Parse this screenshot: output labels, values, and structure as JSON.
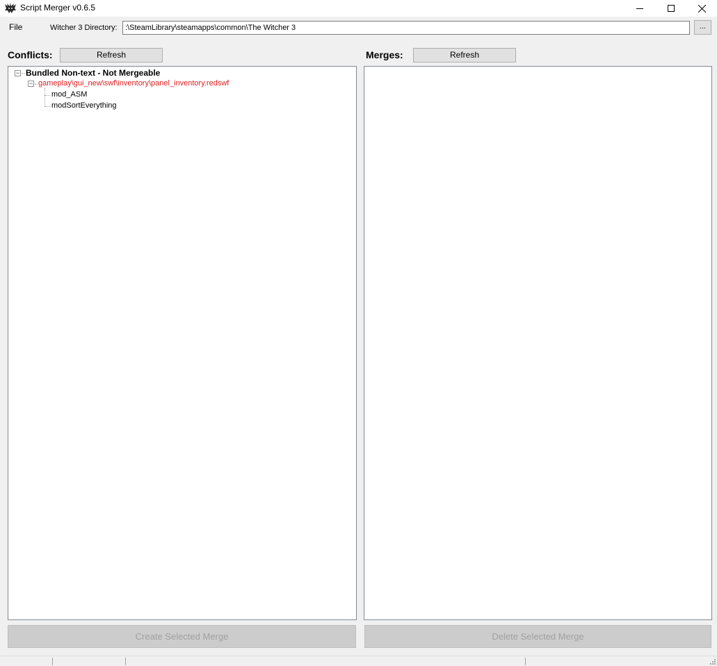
{
  "window": {
    "title": "Script Merger v0.6.5",
    "icons": [
      "witcher-wolf-icon",
      "minimize-icon",
      "maximize-icon",
      "close-icon"
    ]
  },
  "menu": {
    "file": "File"
  },
  "directory": {
    "label": "Witcher 3 Directory:",
    "value": ":\\SteamLibrary\\steamapps\\common\\The Witcher 3",
    "browse_label": "..."
  },
  "conflicts": {
    "label": "Conflicts:",
    "refresh_label": "Refresh",
    "tree": {
      "category": "Bundled Non-text - Not Mergeable",
      "file": "gameplay\\gui_new\\swf\\inventory\\panel_inventory.redswf",
      "file_color": "#e02020",
      "mods": [
        "mod_ASM",
        "modSortEverything"
      ]
    }
  },
  "merges": {
    "label": "Merges:",
    "refresh_label": "Refresh"
  },
  "actions": {
    "create_label": "Create Selected Merge",
    "delete_label": "Delete Selected Merge"
  }
}
